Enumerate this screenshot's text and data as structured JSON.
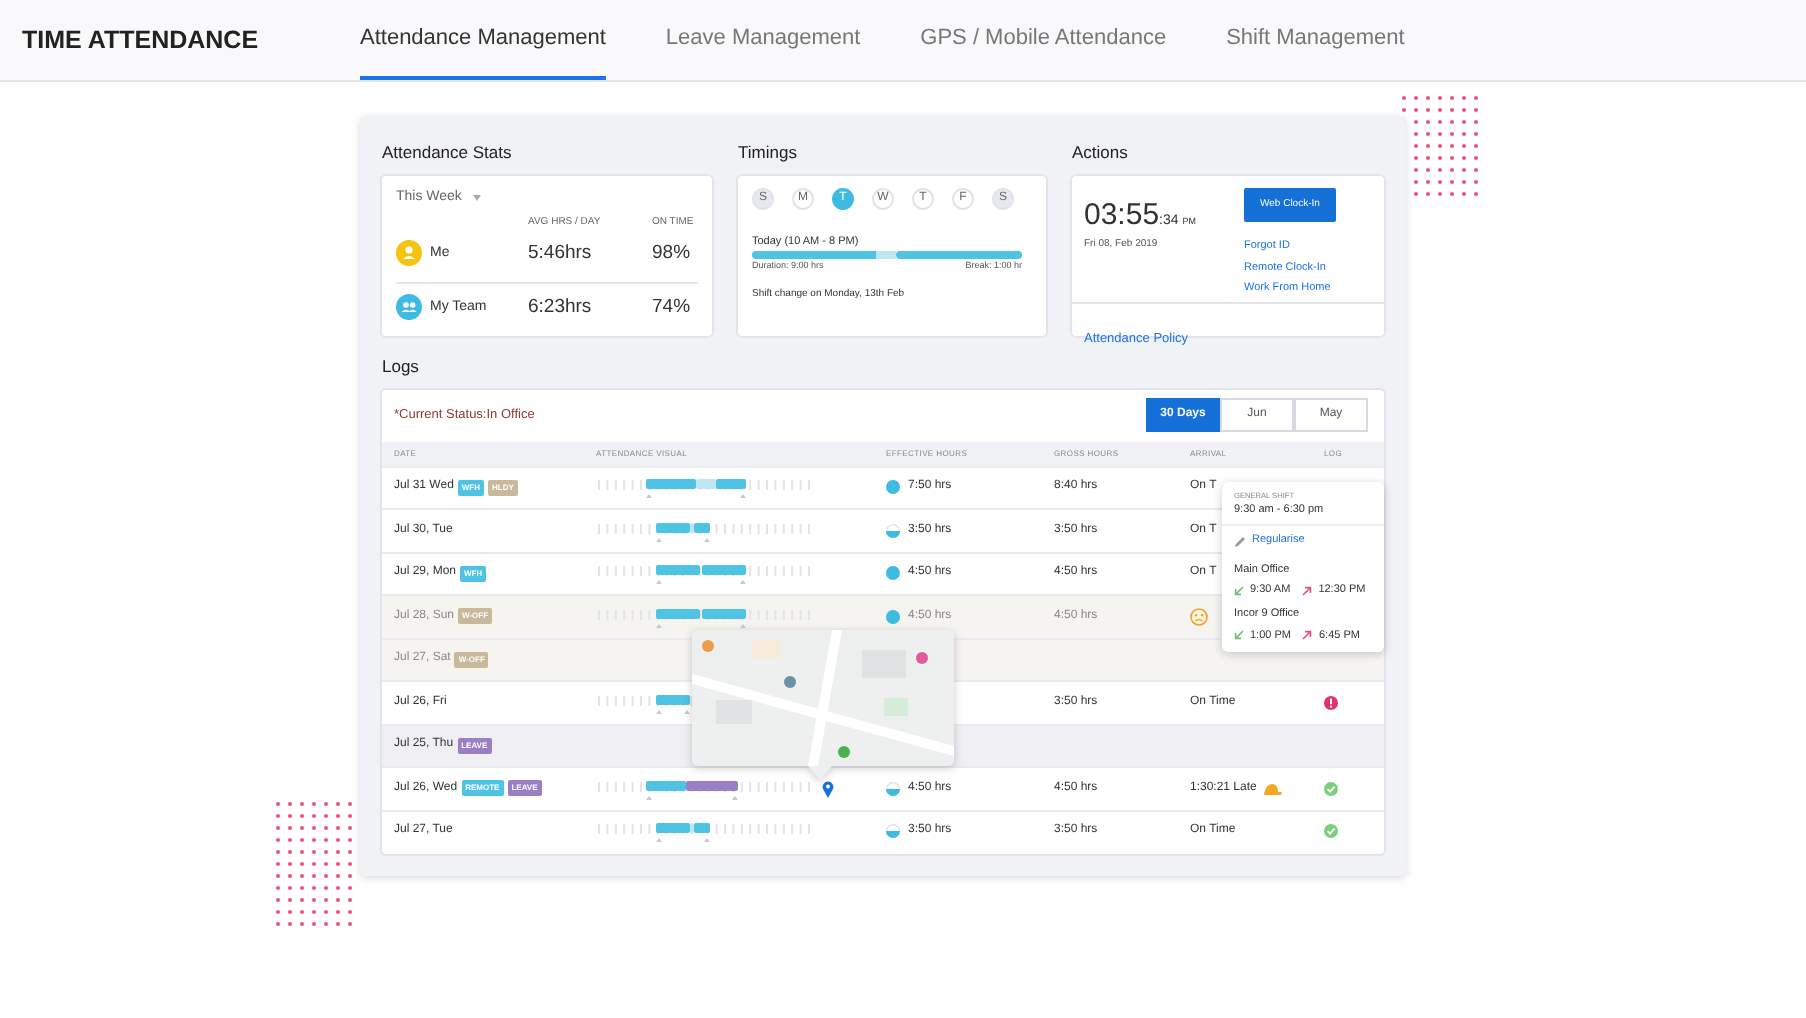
{
  "header": {
    "title": "TIME ATTENDANCE",
    "tabs": [
      {
        "label": "Attendance Management",
        "selected": true
      },
      {
        "label": "Leave Management",
        "selected": false
      },
      {
        "label": "GPS / Mobile Attendance",
        "selected": false
      },
      {
        "label": "Shift Management",
        "selected": false
      }
    ]
  },
  "stats": {
    "title": "Attendance Stats",
    "period": "This Week",
    "columns": [
      "AVG HRS / DAY",
      "ON TIME"
    ],
    "rows": [
      {
        "kind": "me",
        "name": "Me",
        "avg": "5:46hrs",
        "on_time": "98%"
      },
      {
        "kind": "team",
        "name": "My Team",
        "avg": "6:23hrs",
        "on_time": "74%"
      }
    ]
  },
  "timings": {
    "title": "Timings",
    "days": [
      {
        "label": "S",
        "selected": false,
        "off": true
      },
      {
        "label": "M",
        "selected": false,
        "off": false
      },
      {
        "label": "T",
        "selected": true,
        "off": false
      },
      {
        "label": "W",
        "selected": false,
        "off": false
      },
      {
        "label": "T",
        "selected": false,
        "off": false
      },
      {
        "label": "F",
        "selected": false,
        "off": false
      },
      {
        "label": "S",
        "selected": false,
        "off": true
      }
    ],
    "today": "Today (10 AM - 8 PM)",
    "duration": "Duration: 9:00 hrs",
    "break": "Break: 1:00 hr",
    "note": "Shift change on Monday, 13th Feb"
  },
  "actions": {
    "title": "Actions",
    "time": "03:55",
    "seconds": ":34",
    "meridiem": "PM",
    "date": "Fri 08, Feb 2019",
    "button": "Web Clock-In",
    "links": [
      "Forgot ID",
      "Remote Clock-In",
      "Work From Home"
    ],
    "footer_link": "Attendance Policy"
  },
  "logs": {
    "title": "Logs",
    "status": "*Current Status:In Office",
    "ranges": [
      {
        "label": "30 Days",
        "selected": true
      },
      {
        "label": "Jun",
        "selected": false
      },
      {
        "label": "May",
        "selected": false
      }
    ],
    "columns": [
      "DATE",
      "ATTENDANCE VISUAL",
      "EFFECTIVE HOURS",
      "GROSS HOURS",
      "ARRIVAL",
      "LOG"
    ],
    "rows": [
      {
        "kind": "workday",
        "date": "Jul 31 Wed",
        "tags": [
          {
            "label": "WFH",
            "color": "#4fc3e3"
          },
          {
            "label": "HLDY",
            "color": "#c8b99b"
          }
        ],
        "visual": {
          "kind": "split"
        },
        "effective_icon": {
          "kind": "full"
        },
        "effective": "7:50 hrs",
        "gross": "8:40 hrs",
        "arrival": "On T"
      },
      {
        "kind": "workday",
        "date": "Jul 30, Tue",
        "tags": [],
        "visual": {
          "kind": "short-split"
        },
        "effective_icon": {
          "kind": "half"
        },
        "effective": "3:50 hrs",
        "gross": "3:50 hrs",
        "arrival": "On T"
      },
      {
        "kind": "workday",
        "date": "Jul 29, Mon",
        "tags": [
          {
            "label": "WFH",
            "color": "#4fc3e3"
          }
        ],
        "visual": {
          "kind": "two"
        },
        "effective_icon": {
          "kind": "full"
        },
        "effective": "4:50 hrs",
        "gross": "4:50 hrs",
        "arrival": "On T"
      },
      {
        "kind": "weekend",
        "date": "Jul 28, Sun",
        "tags": [
          {
            "label": "W-OFF",
            "color": "#c8b99b"
          }
        ],
        "visual": {
          "kind": "two"
        },
        "effective_icon": {
          "kind": "full"
        },
        "effective": "4:50 hrs",
        "gross": "4:50 hrs",
        "arrival_icon": {
          "kind": "face"
        }
      },
      {
        "kind": "weekend",
        "date": "Jul 27, Sat",
        "tags": [
          {
            "label": "W-OFF",
            "color": "#c8b99b"
          }
        ]
      },
      {
        "kind": "workday",
        "date": "Jul 26, Fri",
        "tags": [],
        "visual": {
          "kind": "short"
        },
        "gross": "3:50 hrs",
        "arrival": "On Time",
        "log_icon": {
          "kind": "error"
        }
      },
      {
        "kind": "leave",
        "date": "Jul 25, Thu",
        "tags": [
          {
            "label": "LEAVE",
            "color": "#9b7fc4"
          }
        ]
      },
      {
        "kind": "workday",
        "date": "Jul 26, Wed",
        "tags": [
          {
            "label": "REMOTE",
            "color": "#4fc3e3"
          },
          {
            "label": "LEAVE",
            "color": "#9b7fc4"
          }
        ],
        "visual": {
          "kind": "leave"
        },
        "pin": true,
        "effective_icon": {
          "kind": "half"
        },
        "effective": "4:50 hrs",
        "gross": "4:50 hrs",
        "arrival": "1:30:21 Late",
        "arrival_icon": {
          "kind": "late"
        },
        "log_icon": {
          "kind": "ok"
        }
      },
      {
        "kind": "workday",
        "date": "Jul 27, Tue",
        "tags": [],
        "visual": {
          "kind": "short-split"
        },
        "effective_icon": {
          "kind": "half"
        },
        "effective": "3:50 hrs",
        "gross": "3:50 hrs",
        "arrival": "On Time",
        "log_icon": {
          "kind": "ok"
        }
      }
    ],
    "map": {
      "kind": "picture"
    },
    "popover": {
      "title": "GENERAL SHIFT",
      "hours": "9:30 am - 6:30 pm",
      "link": "Regularise",
      "offices": [
        {
          "name": "Main Office",
          "in": "9:30 AM",
          "out": "12:30 PM"
        },
        {
          "name": "Incor 9 Office",
          "in": "1:00 PM",
          "out": "6:45 PM"
        }
      ]
    }
  }
}
